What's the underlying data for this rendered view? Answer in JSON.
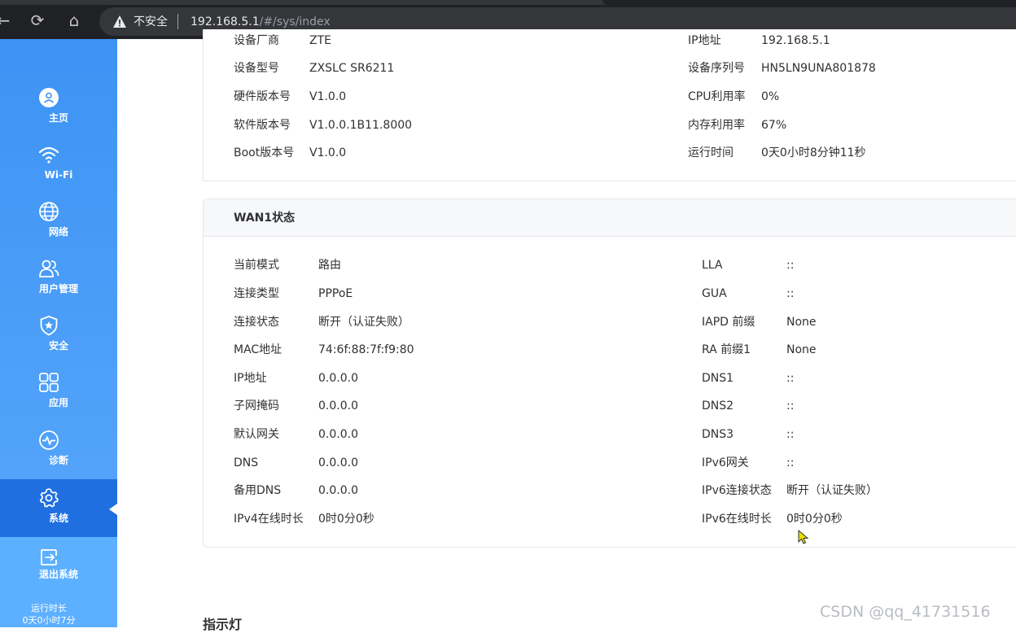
{
  "browser": {
    "security_label": "不安全",
    "url_host": "192.168.5.1",
    "url_path": "/#/sys/index",
    "icons": [
      "back-icon",
      "reload-icon",
      "home-icon",
      "warning-icon"
    ]
  },
  "sidebar": {
    "items": [
      {
        "label": "主页",
        "icon": "home-person-icon"
      },
      {
        "label": "Wi-Fi",
        "icon": "wifi-icon"
      },
      {
        "label": "网络",
        "icon": "globe-icon"
      },
      {
        "label": "用户管理",
        "icon": "users-icon"
      },
      {
        "label": "安全",
        "icon": "shield-icon"
      },
      {
        "label": "应用",
        "icon": "apps-icon"
      },
      {
        "label": "诊断",
        "icon": "pulse-icon"
      },
      {
        "label": "系统",
        "icon": "gear-icon"
      }
    ],
    "active": "系统",
    "logout": {
      "label": "退出系统",
      "icon": "logout-icon"
    },
    "uptime_label": "运行时长",
    "uptime_value": "0天0小时7分"
  },
  "device": {
    "left": [
      {
        "label": "设备厂商",
        "value": "ZTE"
      },
      {
        "label": "设备型号",
        "value": "ZXSLC SR6211"
      },
      {
        "label": "硬件版本号",
        "value": "V1.0.0"
      },
      {
        "label": "软件版本号",
        "value": "V1.0.0.1B11.8000"
      },
      {
        "label": "Boot版本号",
        "value": "V1.0.0"
      }
    ],
    "right": [
      {
        "label": "IP地址",
        "value": "192.168.5.1"
      },
      {
        "label": "设备序列号",
        "value": "HN5LN9UNA801878"
      },
      {
        "label": "CPU利用率",
        "value": "0%"
      },
      {
        "label": "内存利用率",
        "value": "67%"
      },
      {
        "label": "运行时间",
        "value": "0天0小时8分钟11秒"
      }
    ]
  },
  "wan": {
    "title": "WAN1状态",
    "left": [
      {
        "label": "当前模式",
        "value": "路由"
      },
      {
        "label": "连接类型",
        "value": "PPPoE"
      },
      {
        "label": "连接状态",
        "value": "断开（认证失败）"
      },
      {
        "label": "MAC地址",
        "value": "74:6f:88:7f:f9:80"
      },
      {
        "label": "IP地址",
        "value": "0.0.0.0"
      },
      {
        "label": "子网掩码",
        "value": "0.0.0.0"
      },
      {
        "label": "默认网关",
        "value": "0.0.0.0"
      },
      {
        "label": "DNS",
        "value": "0.0.0.0"
      },
      {
        "label": "备用DNS",
        "value": "0.0.0.0"
      },
      {
        "label": "IPv4在线时长",
        "value": "0时0分0秒"
      }
    ],
    "right": [
      {
        "label": "LLA",
        "value": "::"
      },
      {
        "label": "GUA",
        "value": "::"
      },
      {
        "label": "IAPD 前缀",
        "value": "None"
      },
      {
        "label": "RA 前缀1",
        "value": "None"
      },
      {
        "label": "DNS1",
        "value": "::"
      },
      {
        "label": "DNS2",
        "value": "::"
      },
      {
        "label": "DNS3",
        "value": "::"
      },
      {
        "label": "IPv6网关",
        "value": "::"
      },
      {
        "label": "IPv6连接状态",
        "value": "断开（认证失败）"
      },
      {
        "label": "IPv6在线时长",
        "value": "0时0分0秒"
      }
    ]
  },
  "next_section_title": "指示灯",
  "watermark": "CSDN @qq_41731516"
}
